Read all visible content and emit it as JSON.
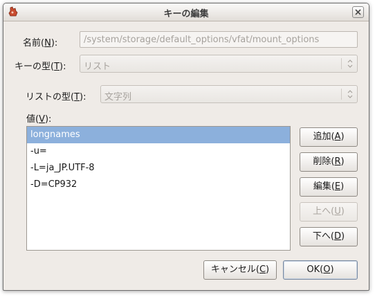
{
  "window": {
    "title": "キーの編集",
    "icon": "gconf-editor-icon"
  },
  "form": {
    "name_label": "名前(",
    "name_mnemonic": "N",
    "name_label_end": "):",
    "name_value": "/system/storage/default_options/vfat/mount_options",
    "key_type_label": "キーの型(",
    "key_type_mnemonic": "T",
    "key_type_label_end": "):",
    "key_type_value": "リスト",
    "list_type_label": "リストの型(",
    "list_type_mnemonic": "T",
    "list_type_label_end": "):",
    "list_type_value": "文字列",
    "values_label": "値(",
    "values_mnemonic": "V",
    "values_label_end": "):"
  },
  "values": [
    "longnames",
    "-u=",
    "-L=ja_JP.UTF-8",
    "-D=CP932"
  ],
  "side_buttons": {
    "add": {
      "label": "追加(",
      "mnemonic": "A",
      "end": ")"
    },
    "remove": {
      "label": "削除(",
      "mnemonic": "R",
      "end": ")"
    },
    "edit": {
      "label": "編集(",
      "mnemonic": "E",
      "end": ")"
    },
    "up": {
      "label": "上へ(",
      "mnemonic": "U",
      "end": ")"
    },
    "down": {
      "label": "下へ(",
      "mnemonic": "D",
      "end": ")"
    }
  },
  "footer": {
    "cancel": {
      "label": "キャンセル(",
      "mnemonic": "C",
      "end": ")"
    },
    "ok": {
      "label": "OK(",
      "mnemonic": "O",
      "end": ")"
    }
  }
}
